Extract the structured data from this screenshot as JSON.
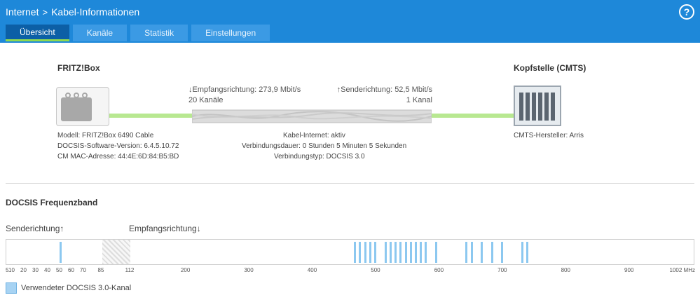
{
  "header": {
    "breadcrumb_root": "Internet",
    "breadcrumb_sep": ">",
    "breadcrumb_page": "Kabel-Informationen",
    "help_label": "?"
  },
  "tabs": [
    {
      "label": "Übersicht",
      "active": true
    },
    {
      "label": "Kanäle",
      "active": false
    },
    {
      "label": "Statistik",
      "active": false
    },
    {
      "label": "Einstellungen",
      "active": false
    }
  ],
  "device": {
    "title": "FRITZ!Box",
    "model": "Modell: FRITZ!Box 6490 Cable",
    "docsis_version": "DOCSIS-Software-Version: 6.4.5.10.72",
    "mac": "CM MAC-Adresse: 44:4E:6D:84:B5:BD",
    "icon": "router-icon"
  },
  "cmts": {
    "title": "Kopfstelle (CMTS)",
    "vendor": "CMTS-Hersteller: Arris",
    "icon": "cmts-server-icon"
  },
  "link": {
    "downstream_rate": "↓Empfangsrichtung: 273,9 Mbit/s",
    "downstream_channels": "20 Kanäle",
    "upstream_rate": "↑Senderichtung: 52,5 Mbit/s",
    "upstream_channels": "1 Kanal",
    "status": "Kabel-Internet: aktiv",
    "duration": "Verbindungsdauer: 0 Stunden 5 Minuten 5 Sekunden",
    "type": "Verbindungstyp: DOCSIS 3.0"
  },
  "band": {
    "title": "DOCSIS Frequenzband",
    "upstream_label": "Senderichtung↑",
    "downstream_label": "Empfangsrichtung↓",
    "upstream_channels_mhz": [
      50
    ],
    "downstream_channels_mhz": [
      466,
      474,
      482,
      490,
      498,
      514,
      522,
      530,
      538,
      546,
      554,
      562,
      570,
      578,
      594,
      642,
      650,
      666,
      682,
      698,
      730,
      738
    ],
    "ticks": [
      "5",
      "10",
      "20",
      "30",
      "40",
      "50",
      "60",
      "70",
      "85",
      "112",
      "200",
      "300",
      "400",
      "500",
      "600",
      "700",
      "800",
      "900",
      "1002 MHz"
    ],
    "legend": "Verwendeter DOCSIS 3.0-Kanal",
    "colors": {
      "channel": "#8cc8f0",
      "accent": "#1e88d9",
      "active_tab": "#0c5fa6",
      "link": "#b8e891"
    }
  }
}
